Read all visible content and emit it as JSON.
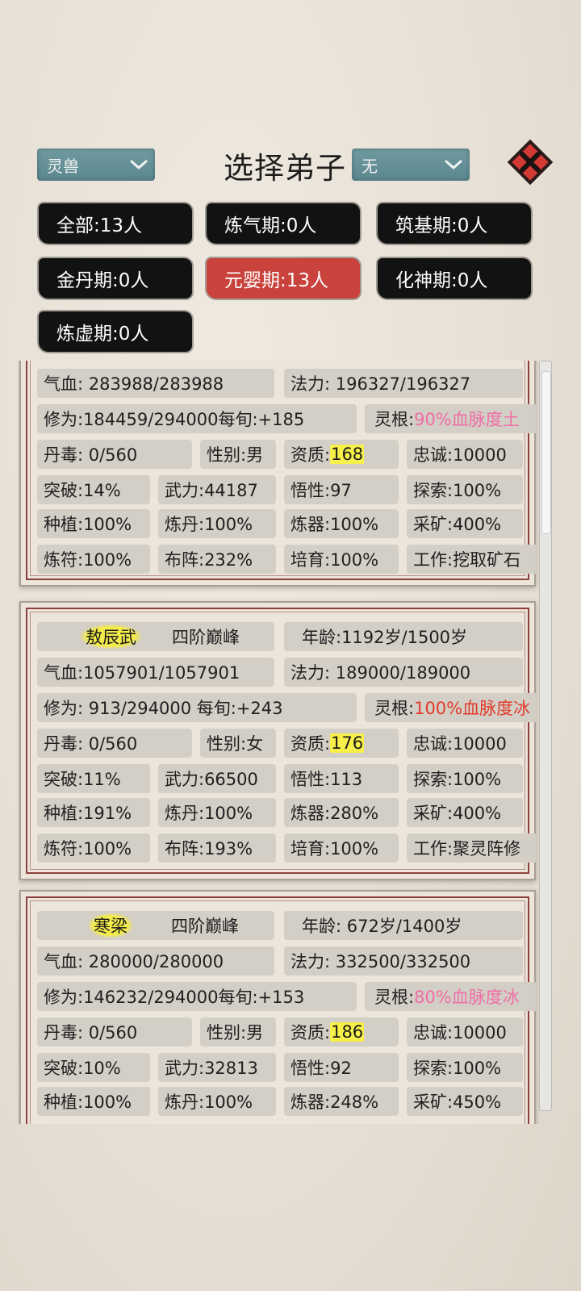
{
  "header": {
    "left_dropdown": "灵兽",
    "title": "选择弟子",
    "right_dropdown": "无",
    "close_icon": "close-icon"
  },
  "filters": [
    {
      "label": "全部:13人",
      "active": false
    },
    {
      "label": "炼气期:0人",
      "active": false
    },
    {
      "label": "筑基期:0人",
      "active": false
    },
    {
      "label": "金丹期:0人",
      "active": false
    },
    {
      "label": "元婴期:13人",
      "active": true
    },
    {
      "label": "化神期:0人",
      "active": false
    },
    {
      "label": "炼虚期:0人",
      "active": false
    }
  ],
  "cards": [
    {
      "hp": "气血:  283988/283988",
      "mana": "法力:  196327/196327",
      "cultivation": "修为:184459/294000每旬:+185",
      "root_label": "灵根:",
      "root_value": "90%血脉度土",
      "poison": "丹毒:     0/560",
      "gender": "性别:男",
      "aptitude_label": "资质:",
      "aptitude_value": "168",
      "loyalty": "忠诚:10000",
      "breakthrough": "突破:14%",
      "force": "武力:44187",
      "insight": "悟性:97",
      "explore": "探索:100%",
      "plant": "种植:100%",
      "alchemy": "炼丹:100%",
      "forge": "炼器:100%",
      "mining": "采矿:400%",
      "talisman": "炼符:100%",
      "formation": "布阵:232%",
      "nurture": "培育:100%",
      "work": "工作:挖取矿石"
    },
    {
      "name": "敖辰武",
      "realm": "四阶巅峰",
      "age": "年龄:1192岁/1500岁",
      "hp": "气血:1057901/1057901",
      "mana": "法力:  189000/189000",
      "cultivation": "修为:   913/294000   每旬:+243",
      "root_label": "灵根:",
      "root_value": "100%血脉度冰",
      "poison": "丹毒:     0/560",
      "gender": "性别:女",
      "aptitude_label": "资质:",
      "aptitude_value": "176",
      "loyalty": "忠诚:10000",
      "breakthrough": "突破:11%",
      "force": "武力:66500",
      "insight": "悟性:113",
      "explore": "探索:100%",
      "plant": "种植:191%",
      "alchemy": "炼丹:100%",
      "forge": "炼器:280%",
      "mining": "采矿:400%",
      "talisman": "炼符:100%",
      "formation": "布阵:193%",
      "nurture": "培育:100%",
      "work": "工作:聚灵阵修"
    },
    {
      "name": "寒梁",
      "realm": "四阶巅峰",
      "age": "年龄:  672岁/1400岁",
      "hp": "气血:  280000/280000",
      "mana": "法力:  332500/332500",
      "cultivation": "修为:146232/294000每旬:+153",
      "root_label": "灵根:",
      "root_value": "80%血脉度冰",
      "poison": "丹毒:     0/560",
      "gender": "性别:男",
      "aptitude_label": "资质:",
      "aptitude_value": "186",
      "loyalty": "忠诚:10000",
      "breakthrough": "突破:10%",
      "force": "武力:32813",
      "insight": "悟性:92",
      "explore": "探索:100%",
      "plant": "种植:100%",
      "alchemy": "炼丹:100%",
      "forge": "炼器:248%",
      "mining": "采矿:450%"
    }
  ],
  "colors": {
    "accent_red": "#c9423b",
    "dropdown_teal": "#6f9aa0",
    "root_pink": "#ef6ea6",
    "root_red": "#e23a2b",
    "aptitude_yellow": "#f7f04a"
  }
}
